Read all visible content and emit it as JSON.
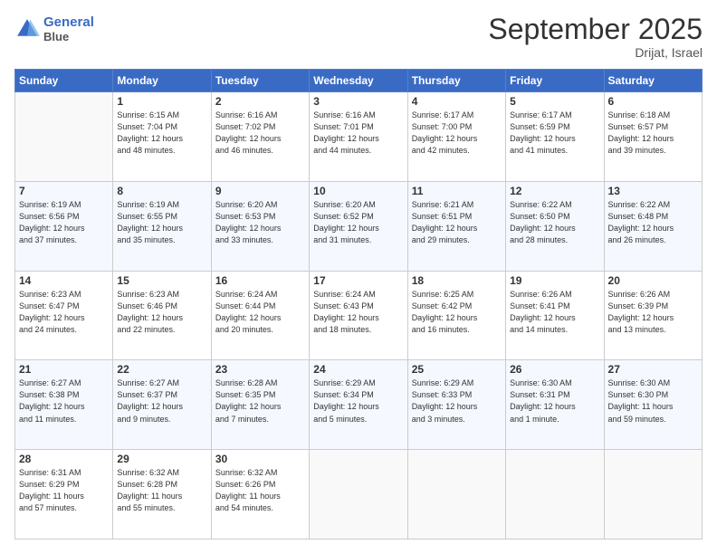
{
  "header": {
    "logo_line1": "General",
    "logo_line2": "Blue",
    "month_title": "September 2025",
    "location": "Drijat, Israel"
  },
  "weekdays": [
    "Sunday",
    "Monday",
    "Tuesday",
    "Wednesday",
    "Thursday",
    "Friday",
    "Saturday"
  ],
  "weeks": [
    [
      {
        "day": "",
        "info": ""
      },
      {
        "day": "1",
        "info": "Sunrise: 6:15 AM\nSunset: 7:04 PM\nDaylight: 12 hours\nand 48 minutes."
      },
      {
        "day": "2",
        "info": "Sunrise: 6:16 AM\nSunset: 7:02 PM\nDaylight: 12 hours\nand 46 minutes."
      },
      {
        "day": "3",
        "info": "Sunrise: 6:16 AM\nSunset: 7:01 PM\nDaylight: 12 hours\nand 44 minutes."
      },
      {
        "day": "4",
        "info": "Sunrise: 6:17 AM\nSunset: 7:00 PM\nDaylight: 12 hours\nand 42 minutes."
      },
      {
        "day": "5",
        "info": "Sunrise: 6:17 AM\nSunset: 6:59 PM\nDaylight: 12 hours\nand 41 minutes."
      },
      {
        "day": "6",
        "info": "Sunrise: 6:18 AM\nSunset: 6:57 PM\nDaylight: 12 hours\nand 39 minutes."
      }
    ],
    [
      {
        "day": "7",
        "info": "Sunrise: 6:19 AM\nSunset: 6:56 PM\nDaylight: 12 hours\nand 37 minutes."
      },
      {
        "day": "8",
        "info": "Sunrise: 6:19 AM\nSunset: 6:55 PM\nDaylight: 12 hours\nand 35 minutes."
      },
      {
        "day": "9",
        "info": "Sunrise: 6:20 AM\nSunset: 6:53 PM\nDaylight: 12 hours\nand 33 minutes."
      },
      {
        "day": "10",
        "info": "Sunrise: 6:20 AM\nSunset: 6:52 PM\nDaylight: 12 hours\nand 31 minutes."
      },
      {
        "day": "11",
        "info": "Sunrise: 6:21 AM\nSunset: 6:51 PM\nDaylight: 12 hours\nand 29 minutes."
      },
      {
        "day": "12",
        "info": "Sunrise: 6:22 AM\nSunset: 6:50 PM\nDaylight: 12 hours\nand 28 minutes."
      },
      {
        "day": "13",
        "info": "Sunrise: 6:22 AM\nSunset: 6:48 PM\nDaylight: 12 hours\nand 26 minutes."
      }
    ],
    [
      {
        "day": "14",
        "info": "Sunrise: 6:23 AM\nSunset: 6:47 PM\nDaylight: 12 hours\nand 24 minutes."
      },
      {
        "day": "15",
        "info": "Sunrise: 6:23 AM\nSunset: 6:46 PM\nDaylight: 12 hours\nand 22 minutes."
      },
      {
        "day": "16",
        "info": "Sunrise: 6:24 AM\nSunset: 6:44 PM\nDaylight: 12 hours\nand 20 minutes."
      },
      {
        "day": "17",
        "info": "Sunrise: 6:24 AM\nSunset: 6:43 PM\nDaylight: 12 hours\nand 18 minutes."
      },
      {
        "day": "18",
        "info": "Sunrise: 6:25 AM\nSunset: 6:42 PM\nDaylight: 12 hours\nand 16 minutes."
      },
      {
        "day": "19",
        "info": "Sunrise: 6:26 AM\nSunset: 6:41 PM\nDaylight: 12 hours\nand 14 minutes."
      },
      {
        "day": "20",
        "info": "Sunrise: 6:26 AM\nSunset: 6:39 PM\nDaylight: 12 hours\nand 13 minutes."
      }
    ],
    [
      {
        "day": "21",
        "info": "Sunrise: 6:27 AM\nSunset: 6:38 PM\nDaylight: 12 hours\nand 11 minutes."
      },
      {
        "day": "22",
        "info": "Sunrise: 6:27 AM\nSunset: 6:37 PM\nDaylight: 12 hours\nand 9 minutes."
      },
      {
        "day": "23",
        "info": "Sunrise: 6:28 AM\nSunset: 6:35 PM\nDaylight: 12 hours\nand 7 minutes."
      },
      {
        "day": "24",
        "info": "Sunrise: 6:29 AM\nSunset: 6:34 PM\nDaylight: 12 hours\nand 5 minutes."
      },
      {
        "day": "25",
        "info": "Sunrise: 6:29 AM\nSunset: 6:33 PM\nDaylight: 12 hours\nand 3 minutes."
      },
      {
        "day": "26",
        "info": "Sunrise: 6:30 AM\nSunset: 6:31 PM\nDaylight: 12 hours\nand 1 minute."
      },
      {
        "day": "27",
        "info": "Sunrise: 6:30 AM\nSunset: 6:30 PM\nDaylight: 11 hours\nand 59 minutes."
      }
    ],
    [
      {
        "day": "28",
        "info": "Sunrise: 6:31 AM\nSunset: 6:29 PM\nDaylight: 11 hours\nand 57 minutes."
      },
      {
        "day": "29",
        "info": "Sunrise: 6:32 AM\nSunset: 6:28 PM\nDaylight: 11 hours\nand 55 minutes."
      },
      {
        "day": "30",
        "info": "Sunrise: 6:32 AM\nSunset: 6:26 PM\nDaylight: 11 hours\nand 54 minutes."
      },
      {
        "day": "",
        "info": ""
      },
      {
        "day": "",
        "info": ""
      },
      {
        "day": "",
        "info": ""
      },
      {
        "day": "",
        "info": ""
      }
    ]
  ]
}
